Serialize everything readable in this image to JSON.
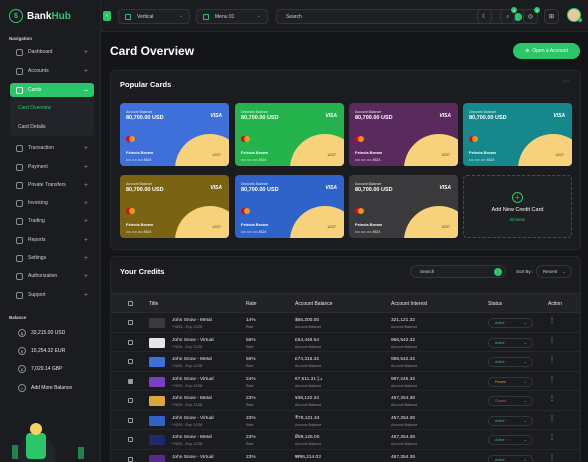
{
  "brand": {
    "name_a": "Bank",
    "name_b": "Hub"
  },
  "sidebar": {
    "nav_heading": "Navigation",
    "items": [
      {
        "label": "Dashboard",
        "icon": "dashboard-icon"
      },
      {
        "label": "Accounts",
        "icon": "accounts-icon"
      },
      {
        "label": "Cards",
        "icon": "cards-icon",
        "active": true
      },
      {
        "label": "Transaction",
        "icon": "transaction-icon"
      },
      {
        "label": "Payment",
        "icon": "payment-icon"
      },
      {
        "label": "Private Transfers",
        "icon": "transfer-icon"
      },
      {
        "label": "Invoicing",
        "icon": "invoice-icon"
      },
      {
        "label": "Trading",
        "icon": "trading-icon"
      },
      {
        "label": "Reports",
        "icon": "reports-icon"
      },
      {
        "label": "Settings",
        "icon": "settings-icon"
      },
      {
        "label": "Authorization",
        "icon": "authorization-icon"
      },
      {
        "label": "Support",
        "icon": "support-icon"
      }
    ],
    "sub_items": [
      {
        "label": "Card Overview",
        "selected": true
      },
      {
        "label": "Card Details"
      }
    ],
    "balance_heading": "Balance",
    "balances": [
      {
        "symbol": "$",
        "value": "33,215.00 USD"
      },
      {
        "symbol": "€",
        "value": "15,254.32 EUR"
      },
      {
        "symbol": "£",
        "value": "7,029.14 GBP"
      },
      {
        "symbol": "+",
        "value": "Add More Balance"
      }
    ]
  },
  "topbar": {
    "vertical_label": "Vertical",
    "menu_label": "Menu 01",
    "search_placeholder": "Search",
    "notif_badge": "4",
    "msg_badge": "3"
  },
  "page": {
    "title": "Card Overview",
    "open_account_label": "Open a Account"
  },
  "popular_cards": {
    "title": "Popular Cards",
    "cards": [
      {
        "label": "Account Balance",
        "amount": "80,700.00 USD",
        "brand": "VISA",
        "name": "Felecia Brown",
        "number": "•••• •••• •••• 8624",
        "expiry": "12/27",
        "color": "#3f6fd8"
      },
      {
        "label": "Deposits Balance",
        "amount": "80,700.00 USD",
        "brand": "VISA",
        "name": "Felecia Brown",
        "number": "•••• •••• •••• 8624",
        "expiry": "12/27",
        "color": "#24b34d"
      },
      {
        "label": "Account Balance",
        "amount": "80,700.00 USD",
        "brand": "VISA",
        "name": "Felecia Brown",
        "number": "•••• •••• •••• 8624",
        "expiry": "12/27",
        "color": "#5a2a5e"
      },
      {
        "label": "Deposits Balance",
        "amount": "80,700.00 USD",
        "brand": "VISA",
        "name": "Felecia Brown",
        "number": "•••• •••• •••• 8624",
        "expiry": "12/27",
        "color": "#14888a"
      },
      {
        "label": "Account Balance",
        "amount": "80,700.00 USD",
        "brand": "VISA",
        "name": "Felecia Brown",
        "number": "•••• •••• •••• 8624",
        "expiry": "12/27",
        "color": "#7a6414"
      },
      {
        "label": "Deposits Balance",
        "amount": "80,700.00 USD",
        "brand": "VISA",
        "name": "Felecia Brown",
        "number": "•••• •••• •••• 8624",
        "expiry": "12/27",
        "color": "#2f63c9"
      },
      {
        "label": "Account Balance",
        "amount": "80,700.00 USD",
        "brand": "VISA",
        "name": "Felecia Brown",
        "number": "•••• •••• •••• 8624",
        "expiry": "12/27",
        "color": "#3a3a3c"
      }
    ],
    "add_title": "Add New Credit Card",
    "add_browse": "Browse"
  },
  "credits": {
    "title": "Your Credits",
    "search_placeholder": "Search",
    "sort_label": "Sort By :",
    "sort_value": "Recent",
    "headers": {
      "title": "Title",
      "rate": "Rate",
      "balance": "Account Balance",
      "interest": "Account Interest",
      "status": "Status",
      "action": "Action"
    },
    "rows": [
      {
        "name": "John Snow - Metal",
        "sub": "**4291 - Exp: 12/26",
        "rate": "14%",
        "rate_sub": "Rate",
        "balance": "$65,200.00",
        "balance_sub": "Account Balance",
        "interest": "321,121.32",
        "interest_sub": "Account Balance",
        "status": "Active",
        "status_color": "#2bc56a",
        "checked": false,
        "card_color": "#3a3a3c"
      },
      {
        "name": "John Snow - Virtual",
        "sub": "**4291 - Exp: 12/26",
        "rate": "56%",
        "rate_sub": "Rate",
        "balance": "£54,448.54",
        "balance_sub": "Account Balance",
        "interest": "956,542.32",
        "interest_sub": "Account Balance",
        "status": "Active",
        "status_color": "#2bc56a",
        "checked": false,
        "card_color": "#e6e6ea"
      },
      {
        "name": "John Snow - Metal",
        "sub": "**4291 - Exp: 12/26",
        "rate": "56%",
        "rate_sub": "Rate",
        "balance": "£74,315.32",
        "balance_sub": "Account Balance",
        "interest": "956,542.32",
        "interest_sub": "Account Balance",
        "status": "Active",
        "status_color": "#2bc56a",
        "checked": false,
        "card_color": "#3f6fd8"
      },
      {
        "name": "John Snow - Virtual",
        "sub": "**4291 - Exp: 12/26",
        "rate": "24%",
        "rate_sub": "Rate",
        "balance": "€7,511.31 د.إ",
        "balance_sub": "Account Balance",
        "interest": "987,245.32",
        "interest_sub": "Account Balance",
        "status": "Frozen",
        "status_color": "#e8a33a",
        "checked": true,
        "card_color": "#7a3fc2"
      },
      {
        "name": "John Snow - Metal",
        "sub": "**4291 - Exp: 12/26",
        "rate": "23%",
        "rate_sub": "Rate",
        "balance": "¥36,122.34",
        "balance_sub": "Account Balance",
        "interest": "457,254.36",
        "interest_sub": "Account Balance",
        "status": "Closed",
        "status_color": "#e0504a",
        "checked": false,
        "card_color": "#d8a83a"
      },
      {
        "name": "John Snow - Virtual",
        "sub": "**4291 - Exp: 12/26",
        "rate": "23%",
        "rate_sub": "Rate",
        "balance": "₹76,121.34",
        "balance_sub": "Account Balance",
        "interest": "457,254.36",
        "interest_sub": "Account Balance",
        "status": "Active",
        "status_color": "#2bc56a",
        "checked": false,
        "card_color": "#2f63c9"
      },
      {
        "name": "John Snow - Metal",
        "sub": "**4291 - Exp: 12/26",
        "rate": "23%",
        "rate_sub": "Rate",
        "balance": "₽88,125.00",
        "balance_sub": "Account Balance",
        "interest": "457,254.36",
        "interest_sub": "Account Balance",
        "status": "Active",
        "status_color": "#2bc56a",
        "checked": false,
        "card_color": "#1e2a6a"
      },
      {
        "name": "John Snow - Virtual",
        "sub": "**4291 - Exp: 12/26",
        "rate": "23%",
        "rate_sub": "Rate",
        "balance": "₩96,214.03",
        "balance_sub": "Account Balance",
        "interest": "457,254.36",
        "interest_sub": "Account Balance",
        "status": "Active",
        "status_color": "#2bc56a",
        "checked": false,
        "card_color": "#5a2a8a"
      }
    ]
  },
  "colors": {
    "accent": "#2bc56a",
    "bg": "#141518",
    "panel": "#1b1c20"
  }
}
